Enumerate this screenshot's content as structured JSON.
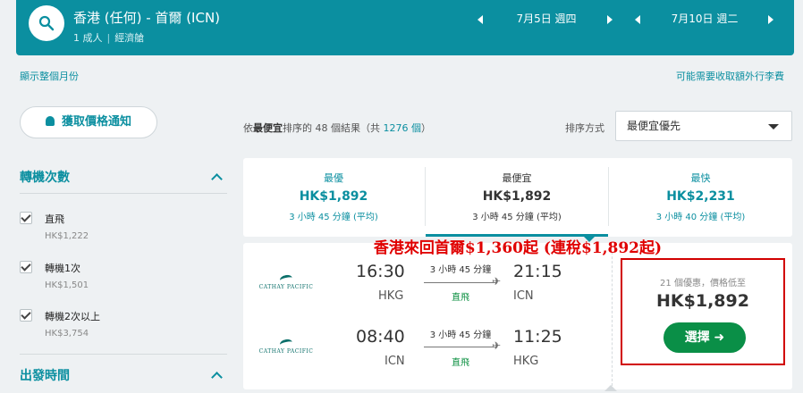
{
  "header": {
    "route": "香港 (任何) - 首爾 (ICN)",
    "passengers": "1 成人",
    "cabin": "經濟艙",
    "depart_date": "7月5日 週四",
    "return_date": "7月10日 週二"
  },
  "links": {
    "show_month": "顯示整個月份",
    "extra_baggage": "可能需要收取額外行李費"
  },
  "sidebar": {
    "price_alert": "獲取價格通知",
    "stops_title": "轉機次數",
    "stops": [
      {
        "label": "直飛",
        "price": "HK$1,222",
        "checked": true
      },
      {
        "label": "轉機1次",
        "price": "HK$1,501",
        "checked": true
      },
      {
        "label": "轉機2次以上",
        "price": "HK$3,754",
        "checked": true
      }
    ],
    "departure_title": "出發時間"
  },
  "results": {
    "summary_prefix": "依",
    "summary_bold": "最便宜",
    "summary_mid": "排序的 48 個結果（共",
    "summary_count": "1276 個",
    "summary_suffix": "）",
    "sort_label": "排序方式",
    "sort_value": "最便宜優先"
  },
  "tabs": [
    {
      "label": "最優",
      "price": "HK$1,892",
      "duration": "3 小時 45 分鐘 (平均)"
    },
    {
      "label": "最便宜",
      "price": "HK$1,892",
      "duration": "3 小時 45 分鐘 (平均)"
    },
    {
      "label": "最快",
      "price": "HK$2,231",
      "duration": "3 小時 40 分鐘 (平均)"
    }
  ],
  "promo_banner": "香港來回首爾$1,360起 (連稅$1,892起)",
  "itinerary": {
    "airline": "CATHAY PACIFIC",
    "legs": [
      {
        "dep_time": "16:30",
        "dep_code": "HKG",
        "duration": "3 小時 45 分鐘",
        "stops": "直飛",
        "arr_time": "21:15",
        "arr_code": "ICN"
      },
      {
        "dep_time": "08:40",
        "dep_code": "ICN",
        "duration": "3 小時 45 分鐘",
        "stops": "直飛",
        "arr_time": "11:25",
        "arr_code": "HKG"
      }
    ],
    "deals_text": "21 個優惠，價格低至",
    "price": "HK$1,892",
    "select_label": "選擇 ➜"
  },
  "colors": {
    "brand": "#0b8fa0",
    "select_button": "#0a8f47",
    "highlight": "#d10000"
  }
}
